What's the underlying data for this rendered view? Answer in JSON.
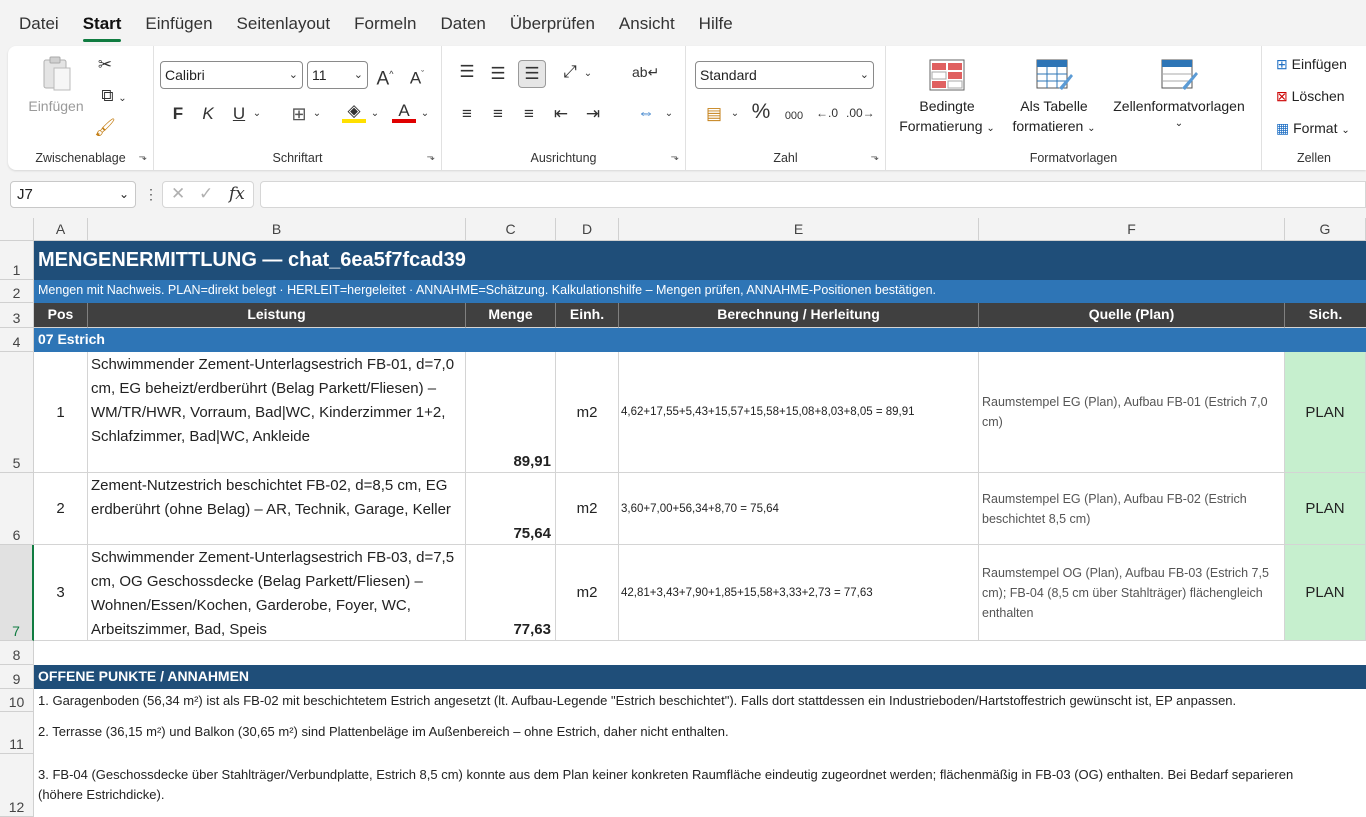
{
  "menu": {
    "tabs": [
      "Datei",
      "Start",
      "Einfügen",
      "Seitenlayout",
      "Formeln",
      "Daten",
      "Überprüfen",
      "Ansicht",
      "Hilfe"
    ],
    "active": "Start"
  },
  "ribbon": {
    "clipboard": {
      "paste": "Einfügen",
      "label": "Zwischenablage"
    },
    "font": {
      "name": "Calibri",
      "size": "11",
      "bold": "F",
      "italic": "K",
      "underline": "U",
      "label": "Schriftart"
    },
    "alignment": {
      "label": "Ausrichtung"
    },
    "number": {
      "format": "Standard",
      "percent": "%",
      "thousands": "000",
      "label": "Zahl"
    },
    "styles": {
      "conditional_1": "Bedingte",
      "conditional_2": "Formatierung",
      "table_1": "Als Tabelle",
      "table_2": "formatieren",
      "cellstyles": "Zellenformatvorlagen",
      "label": "Formatvorlagen"
    },
    "cells": {
      "insert": "Einfügen",
      "delete": "Löschen",
      "format": "Format",
      "label": "Zellen"
    }
  },
  "formula_bar": {
    "namebox": "J7",
    "fx": "fx",
    "formula": ""
  },
  "columns": [
    "A",
    "B",
    "C",
    "D",
    "E",
    "F",
    "G"
  ],
  "rows": [
    "1",
    "2",
    "3",
    "4",
    "5",
    "6",
    "7",
    "8",
    "9",
    "10",
    "11",
    "12"
  ],
  "sheet": {
    "title": "MENGENERMITTLUNG — chat_6ea5f7fcad39",
    "subtitle": "Mengen mit Nachweis. PLAN=direkt belegt · HERLEIT=hergeleitet · ANNAHME=Schätzung. Kalkulationshilfe – Mengen prüfen, ANNAHME-Positionen bestätigen.",
    "headers": [
      "Pos",
      "Leistung",
      "Menge",
      "Einh.",
      "Berechnung / Herleitung",
      "Quelle (Plan)",
      "Sich."
    ],
    "section": "07 Estrich",
    "items": [
      {
        "pos": "1",
        "leistung": "Schwimmender Zement-Unterlagsestrich FB-01, d=7,0 cm, EG beheizt/erdberührt (Belag Parkett/Fliesen) – WM/TR/HWR, Vorraum, Bad|WC, Kinderzimmer 1+2, Schlafzimmer, Bad|WC, Ankleide",
        "menge": "89,91",
        "einheit": "m2",
        "berechnung": "4,62+17,55+5,43+15,57+15,58+15,08+8,03+8,05 = 89,91",
        "quelle": "Raumstempel EG (Plan), Aufbau FB-01 (Estrich 7,0 cm)",
        "sicherheit": "PLAN"
      },
      {
        "pos": "2",
        "leistung": "Zement-Nutzestrich beschichtet FB-02, d=8,5 cm, EG erdberührt (ohne Belag) – AR, Technik, Garage, Keller",
        "menge": "75,64",
        "einheit": "m2",
        "berechnung": "3,60+7,00+56,34+8,70 = 75,64",
        "quelle": "Raumstempel EG (Plan), Aufbau FB-02 (Estrich beschichtet 8,5 cm)",
        "sicherheit": "PLAN"
      },
      {
        "pos": "3",
        "leistung": "Schwimmender Zement-Unterlagsestrich FB-03, d=7,5 cm, OG Geschossdecke (Belag Parkett/Fliesen) – Wohnen/Essen/Kochen, Garderobe, Foyer, WC, Arbeitszimmer, Bad, Speis",
        "menge": "77,63",
        "einheit": "m2",
        "berechnung": "42,81+3,43+7,90+1,85+15,58+3,33+2,73 = 77,63",
        "quelle": "Raumstempel OG (Plan), Aufbau FB-03 (Estrich 7,5 cm); FB-04 (8,5 cm über Stahlträger) flächengleich enthalten",
        "sicherheit": "PLAN"
      }
    ],
    "open_points_title": "OFFENE PUNKTE / ANNAHMEN",
    "notes": [
      "1. Garagenboden (56,34 m²) ist als FB-02 mit beschichtetem Estrich angesetzt (lt. Aufbau-Legende \"Estrich beschichtet\"). Falls dort stattdessen ein Industrieboden/Hartstoffestrich gewünscht ist, EP anpassen.",
      "2. Terrasse (36,15 m²) und Balkon (30,65 m²) sind Plattenbeläge im Außenbereich – ohne Estrich, daher nicht enthalten.",
      "3. FB-04 (Geschossdecke über Stahlträger/Verbundplatte, Estrich 8,5 cm) konnte aus dem Plan keiner konkreten Raumfläche eindeutig zugeordnet werden; flächenmäßig in FB-03 (OG) enthalten. Bei Bedarf separieren (höhere Estrichdicke)."
    ]
  },
  "colors": {
    "accent": "#107c41",
    "title_bg": "#1f4e79",
    "subtitle_bg": "#2e75b6",
    "header_bg": "#404040",
    "plan_bg": "#c6efce"
  }
}
